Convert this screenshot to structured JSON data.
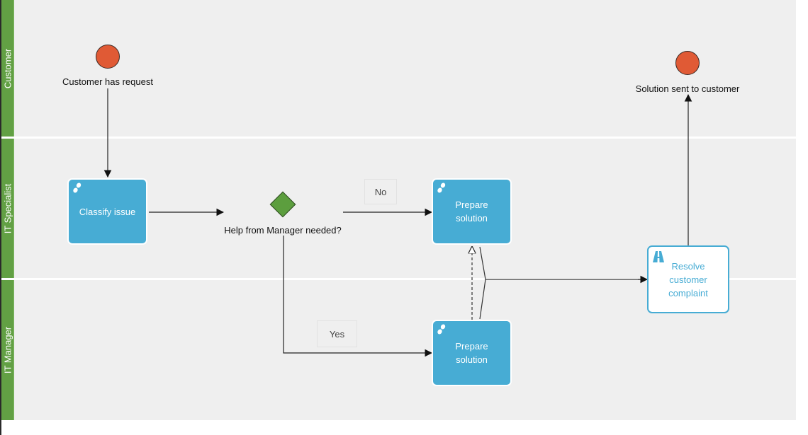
{
  "diagram": {
    "type": "BPMN swimlane process",
    "lanes": [
      {
        "id": "customer",
        "label": "Customer"
      },
      {
        "id": "it_specialist",
        "label": "IT Specialist"
      },
      {
        "id": "it_manager",
        "label": "IT Manager"
      }
    ],
    "events": [
      {
        "id": "start",
        "type": "start-event",
        "lane": "customer",
        "label": "Customer has request"
      },
      {
        "id": "end",
        "type": "end-event",
        "lane": "customer",
        "label": "Solution sent to customer"
      }
    ],
    "tasks": [
      {
        "id": "classify",
        "lane": "it_specialist",
        "label": "Classify issue",
        "icon": "manual-task-footsteps-icon"
      },
      {
        "id": "prepare_specialist",
        "lane": "it_specialist",
        "label": "Prepare solution",
        "icon": "manual-task-footsteps-icon"
      },
      {
        "id": "prepare_manager",
        "lane": "it_manager",
        "label": "Prepare solution",
        "icon": "manual-task-footsteps-icon"
      },
      {
        "id": "resolve",
        "lane": "it_specialist",
        "label": "Resolve customer complaint",
        "icon": "road-subprocess-icon",
        "style": "outlined"
      }
    ],
    "gateways": [
      {
        "id": "help_needed",
        "lane": "it_specialist",
        "label": "Help from Manager needed?"
      }
    ],
    "flows": [
      {
        "from": "start",
        "to": "classify",
        "type": "sequence"
      },
      {
        "from": "classify",
        "to": "help_needed",
        "type": "sequence"
      },
      {
        "from": "help_needed",
        "to": "prepare_specialist",
        "type": "sequence",
        "label": "No"
      },
      {
        "from": "help_needed",
        "to": "prepare_manager",
        "type": "sequence",
        "label": "Yes"
      },
      {
        "from": "prepare_manager",
        "to": "prepare_specialist",
        "type": "association-dashed"
      },
      {
        "from": "prepare_specialist",
        "to": "resolve",
        "type": "merged-sequence"
      },
      {
        "from": "prepare_manager",
        "to": "resolve",
        "type": "merged-sequence"
      },
      {
        "from": "resolve",
        "to": "end",
        "type": "sequence"
      }
    ],
    "colors": {
      "lane_header": "#62a044",
      "lane_background": "#efefef",
      "event": "#e05a35",
      "gateway": "#5c9e3e",
      "task": "#47acd4"
    }
  }
}
